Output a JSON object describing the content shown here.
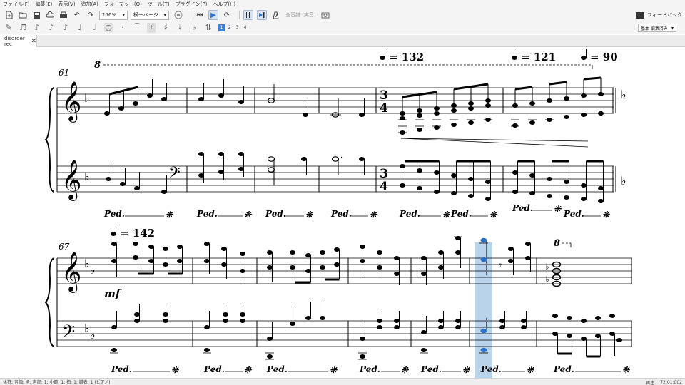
{
  "menu": [
    "ファイル(F)",
    "編集(E)",
    "表示(V)",
    "追加(A)",
    "フォーマット(O)",
    "ツール(T)",
    "プラグイン(P)",
    "ヘルプ(H)"
  ],
  "toolbar": {
    "zoom": "256%",
    "view_mode": "横一ページ",
    "concert_pitch": "全音譜 (実音)",
    "feedback": "フィードバック"
  },
  "note_input": {
    "voices": [
      "1",
      "2",
      "3",
      "4"
    ],
    "active_voice": "1",
    "workspace": "基本 編集済み"
  },
  "tab": {
    "title": "disorder rec"
  },
  "score": {
    "system1_measure": "61",
    "system2_measure": "67",
    "ottava": "8",
    "tempo_mark_1": "= 132",
    "tempo_mark_2": "= 121",
    "tempo_mark_3": "= 90",
    "tempo_mark_4": "= 142",
    "time_sig_top": "3",
    "time_sig_bottom": "4",
    "dynamic": "mf",
    "pedal": "Ped.",
    "pedal_release": "❊",
    "flat": "♭",
    "selection_color": "#b9d3ea",
    "selected_note_color": "#2a72c8"
  },
  "status": {
    "left": "休符; 音価: 全; 声部: 1;  小節: 1; 拍: 1; 譜表: 1 (ピアノ)",
    "mode": "再生",
    "time": "72:01:002"
  }
}
